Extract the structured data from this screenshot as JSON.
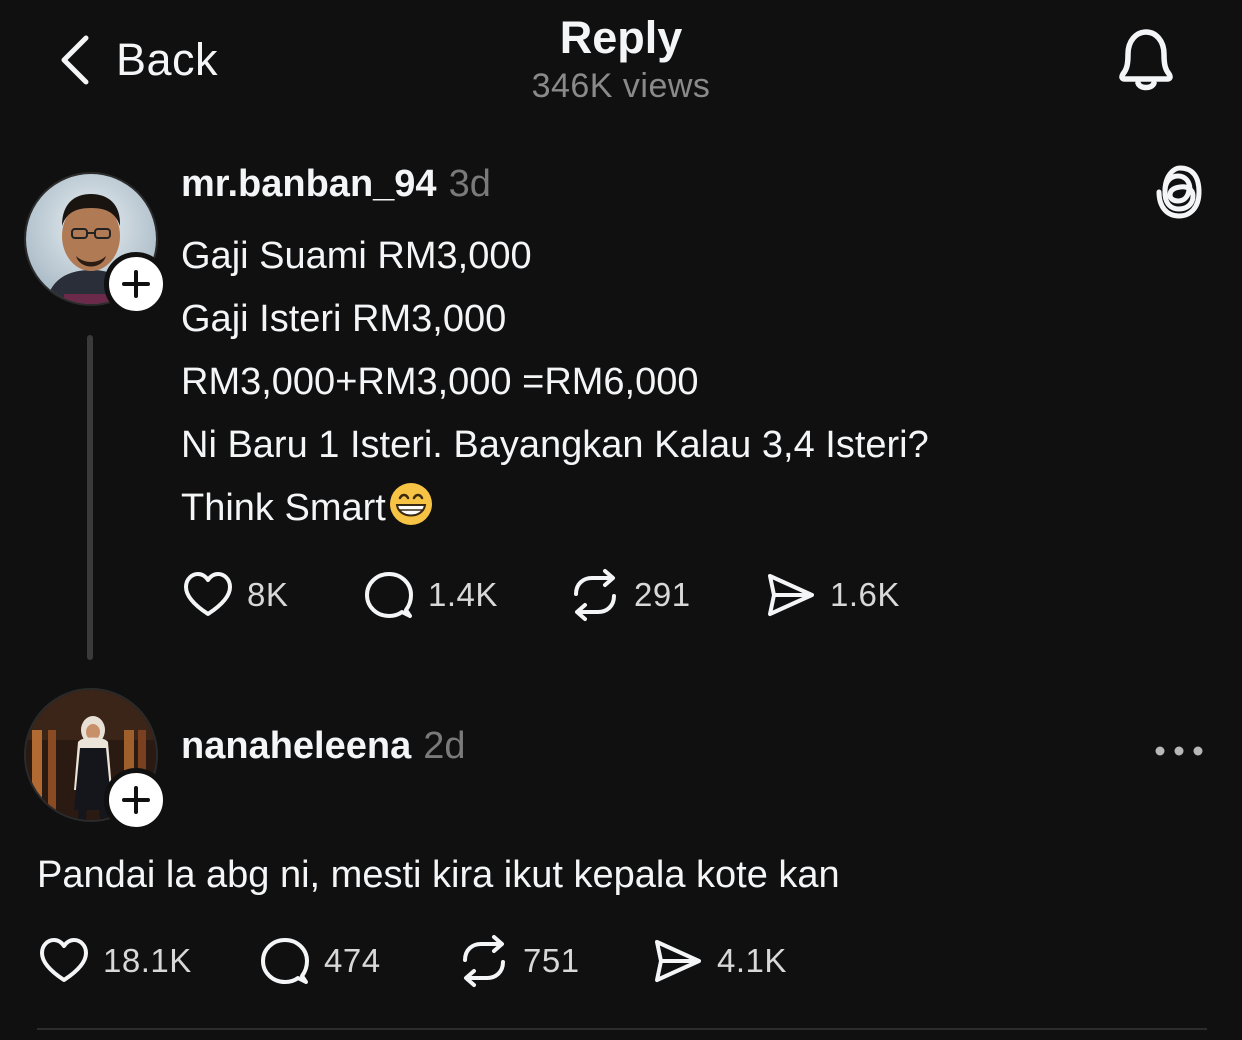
{
  "header": {
    "back_label": "Back",
    "title": "Reply",
    "views": "346K views"
  },
  "post": {
    "username": "mr.banban_94",
    "age": "3d",
    "lines": [
      "Gaji Suami RM3,000",
      "Gaji Isteri RM3,000",
      "RM3,000+RM3,000 =RM6,000",
      "Ni Baru 1 Isteri. Bayangkan Kalau 3,4 Isteri?",
      "Think Smart"
    ],
    "emoji": "grinning-face",
    "likes": "8K",
    "replies": "1.4K",
    "reposts": "291",
    "shares": "1.6K"
  },
  "reply": {
    "username": "nanaheleena",
    "age": "2d",
    "text": "Pandai la abg ni, mesti kira ikut kepala kote kan",
    "likes": "18.1K",
    "replies": "474",
    "reposts": "751",
    "shares": "4.1K"
  },
  "colors": {
    "background": "#101010",
    "text": "#f3f5f7",
    "muted": "#7a7a7a",
    "thread_line": "#3a3a3a"
  }
}
